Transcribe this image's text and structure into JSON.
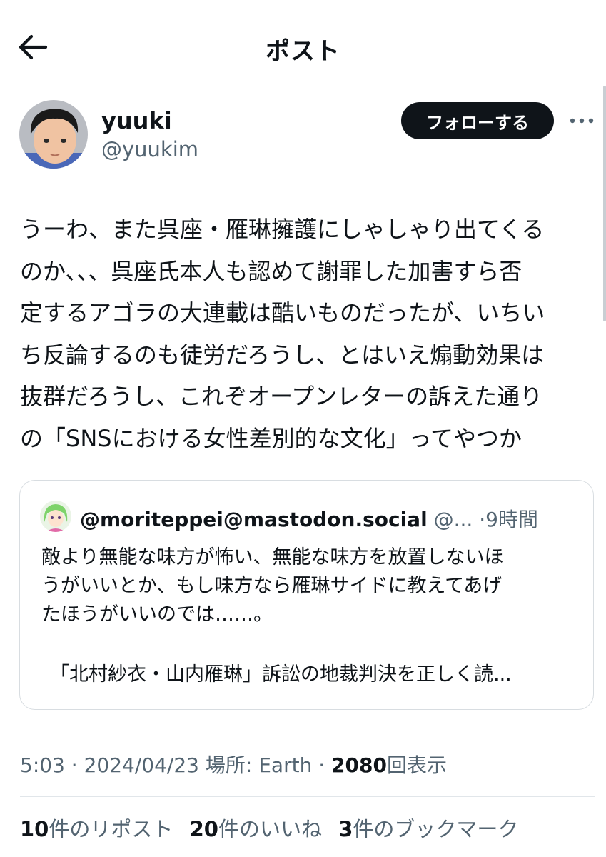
{
  "header": {
    "title": "ポスト"
  },
  "author": {
    "display_name": "yuuki",
    "handle": "@yuukim",
    "follow_label": "フォローする"
  },
  "post": {
    "text": "うーわ、また呉座・雁琳擁護にしゃしゃり出てくる\nのか、、、呉座氏本人も認めて謝罪した加害すら否\n定するアゴラの大連載は酷いものだったが、いちい\nち反論するのも徒労だろうし、とはいえ煽動効果は\n抜群だろうし、これぞオープンレターの訴えた通り\nの「SNSにおける女性差別的な文化」ってやつか"
  },
  "quote": {
    "name": "@moriteppei@mastodon.social",
    "handle_truncated": "@...",
    "separator": "·",
    "time": "9時間",
    "text": "敵より無能な味方が怖い、無能な味方を放置しないほ\nうがいいとか、もし味方なら雁琳サイドに教えてあげ\nたほうがいいのでは……。",
    "link_text": "「北村紗衣・山内雁琳」訴訟の地裁判決を正しく読..."
  },
  "meta": {
    "time": "5:03",
    "sep1": "·",
    "date": "2024/04/23",
    "location_label": "場所: Earth",
    "sep2": "·",
    "views_count": "2080",
    "views_label": "回表示"
  },
  "stats": {
    "reposts_count": "10",
    "reposts_label": "件のリポスト",
    "likes_count": "20",
    "likes_label": "件のいいね",
    "bookmarks_count": "3",
    "bookmarks_label": "件のブックマーク"
  },
  "icons": {
    "back": "arrow-left-icon",
    "more": "more-horizontal-icon"
  },
  "colors": {
    "text": "#0f1419",
    "secondary": "#536471",
    "button_bg": "#0f1419",
    "border": "#d8dde1"
  }
}
